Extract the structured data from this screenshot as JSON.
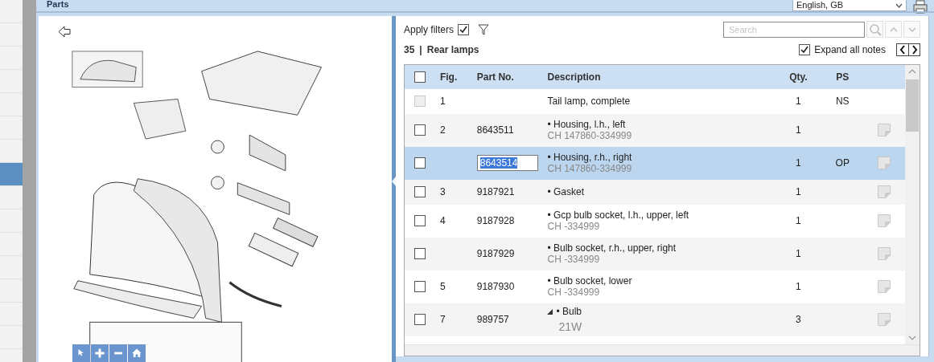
{
  "header": {
    "title": "Parts",
    "language": "English, GB"
  },
  "sidebar": {
    "items": [
      {
        "selected": false
      },
      {
        "selected": false
      },
      {
        "selected": false
      },
      {
        "selected": false
      },
      {
        "selected": false
      },
      {
        "selected": false
      },
      {
        "selected": false
      },
      {
        "selected": true
      },
      {
        "selected": false
      },
      {
        "selected": false
      },
      {
        "selected": false
      },
      {
        "selected": false
      },
      {
        "selected": false
      },
      {
        "selected": false
      },
      {
        "selected": false
      }
    ]
  },
  "diagram": {
    "kind": "picture"
  },
  "zoom_tools": [
    {
      "kind": "pointer"
    },
    {
      "kind": "zoom_in"
    },
    {
      "kind": "zoom_out"
    },
    {
      "kind": "home"
    }
  ],
  "filters": {
    "label": "Apply filters",
    "checked": true
  },
  "search": {
    "placeholder": "Search"
  },
  "group": {
    "number": "35",
    "separator": "|",
    "title": "Rear lamps"
  },
  "expand_notes": {
    "label": "Expand all notes",
    "checked": true
  },
  "table": {
    "header_checked": false,
    "columns": [
      "Fig.",
      "Part No.",
      "Description",
      "Qty.",
      "PS"
    ],
    "rows": [
      {
        "kind": "part",
        "checked": false,
        "disabled": true,
        "selected": false,
        "fig": "1",
        "description": "Tail lamp, complete",
        "qty": "1",
        "ps": "NS",
        "note": false
      },
      {
        "kind": "part",
        "checked": false,
        "disabled": false,
        "selected": false,
        "fig": "2",
        "part_no": "8643511",
        "description": "• Housing, l.h., left",
        "detail": "CH 147860-334999",
        "qty": "1",
        "note": true
      },
      {
        "kind": "part",
        "checked": false,
        "disabled": false,
        "selected": true,
        "part_no": "8643514",
        "description": "• Housing, r.h., right",
        "detail": "CH 147860-334999",
        "qty": "1",
        "ps": "OP",
        "note": true
      },
      {
        "kind": "part",
        "checked": false,
        "disabled": false,
        "selected": false,
        "fig": "3",
        "part_no": "9187921",
        "description": "• Gasket",
        "qty": "1",
        "note": true
      },
      {
        "kind": "part",
        "checked": false,
        "disabled": false,
        "selected": false,
        "fig": "4",
        "part_no": "9187928",
        "description": "• Gcp bulb socket, l.h., upper, left",
        "detail": "CH -334999",
        "qty": "1",
        "note": true
      },
      {
        "kind": "part",
        "checked": false,
        "disabled": false,
        "selected": false,
        "part_no": "9187929",
        "description": "• Bulb socket, r.h., upper, right",
        "detail": "CH -334999",
        "qty": "1",
        "note": true
      },
      {
        "kind": "part",
        "checked": false,
        "disabled": false,
        "selected": false,
        "fig": "5",
        "part_no": "9187930",
        "description": "• Bulb socket, lower",
        "detail": "CH -334999",
        "qty": "1",
        "note": true
      },
      {
        "kind": "assembly",
        "expanded": true,
        "checked": false,
        "disabled": false,
        "selected": false,
        "fig": "7",
        "part_no": "989757",
        "description": "• Bulb",
        "detail": "21W",
        "qty": "3",
        "note": true
      }
    ]
  }
}
